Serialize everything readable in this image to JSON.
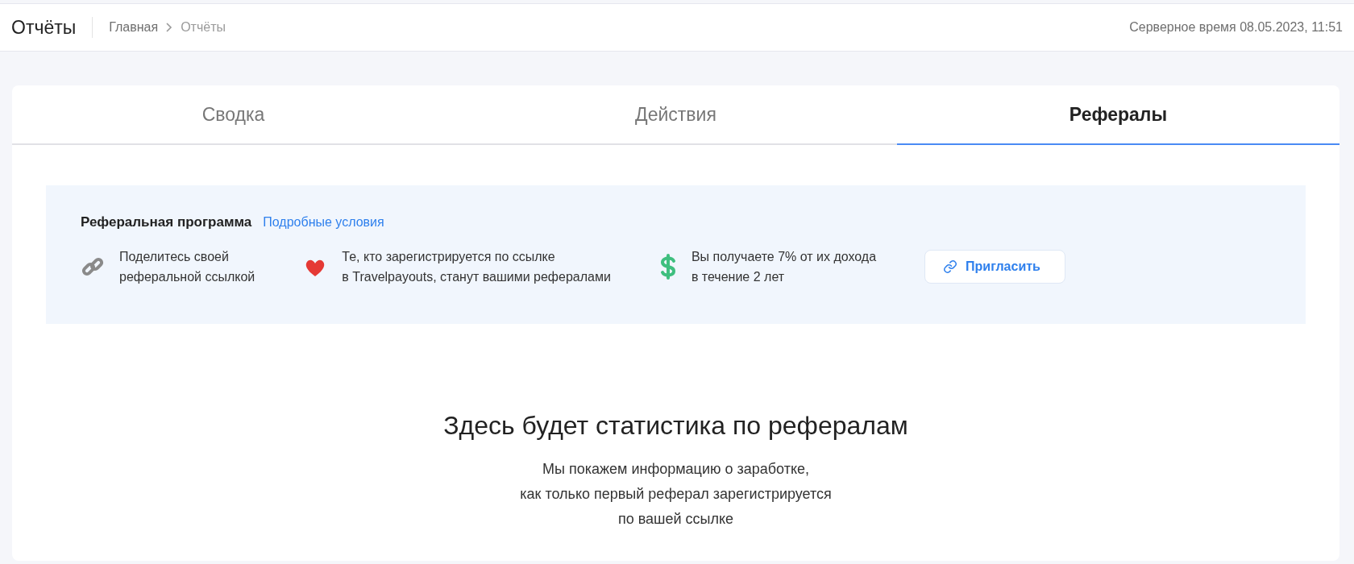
{
  "header": {
    "title": "Отчёты",
    "breadcrumbs": [
      {
        "label": "Главная"
      },
      {
        "label": "Отчёты"
      }
    ],
    "server_time": "Серверное время 08.05.2023, 11:51"
  },
  "tabs": [
    {
      "label": "Сводка",
      "selected": false
    },
    {
      "label": "Действия",
      "selected": false
    },
    {
      "label": "Рефералы",
      "selected": true
    }
  ],
  "referral": {
    "title": "Реферальная программа",
    "link": "Подробные условия",
    "steps": [
      {
        "kind": "link",
        "lines": [
          "Поделитесь своей",
          "реферальной ссылкой"
        ]
      },
      {
        "kind": "heart",
        "lines": [
          "Те, кто зарегистрируется по ссылке",
          "в Travelpayouts, станут вашими рефералами"
        ]
      },
      {
        "kind": "dollar",
        "lines": [
          "Вы получаете 7% от их дохода",
          "в течение 2 лет"
        ]
      }
    ],
    "button": "Пригласить"
  },
  "empty": {
    "title": "Здесь будет статистика по рефералам",
    "lines": [
      "Мы покажем информацию о заработке,",
      "как только первый реферал зарегистрируется",
      "по вашей ссылке"
    ]
  }
}
